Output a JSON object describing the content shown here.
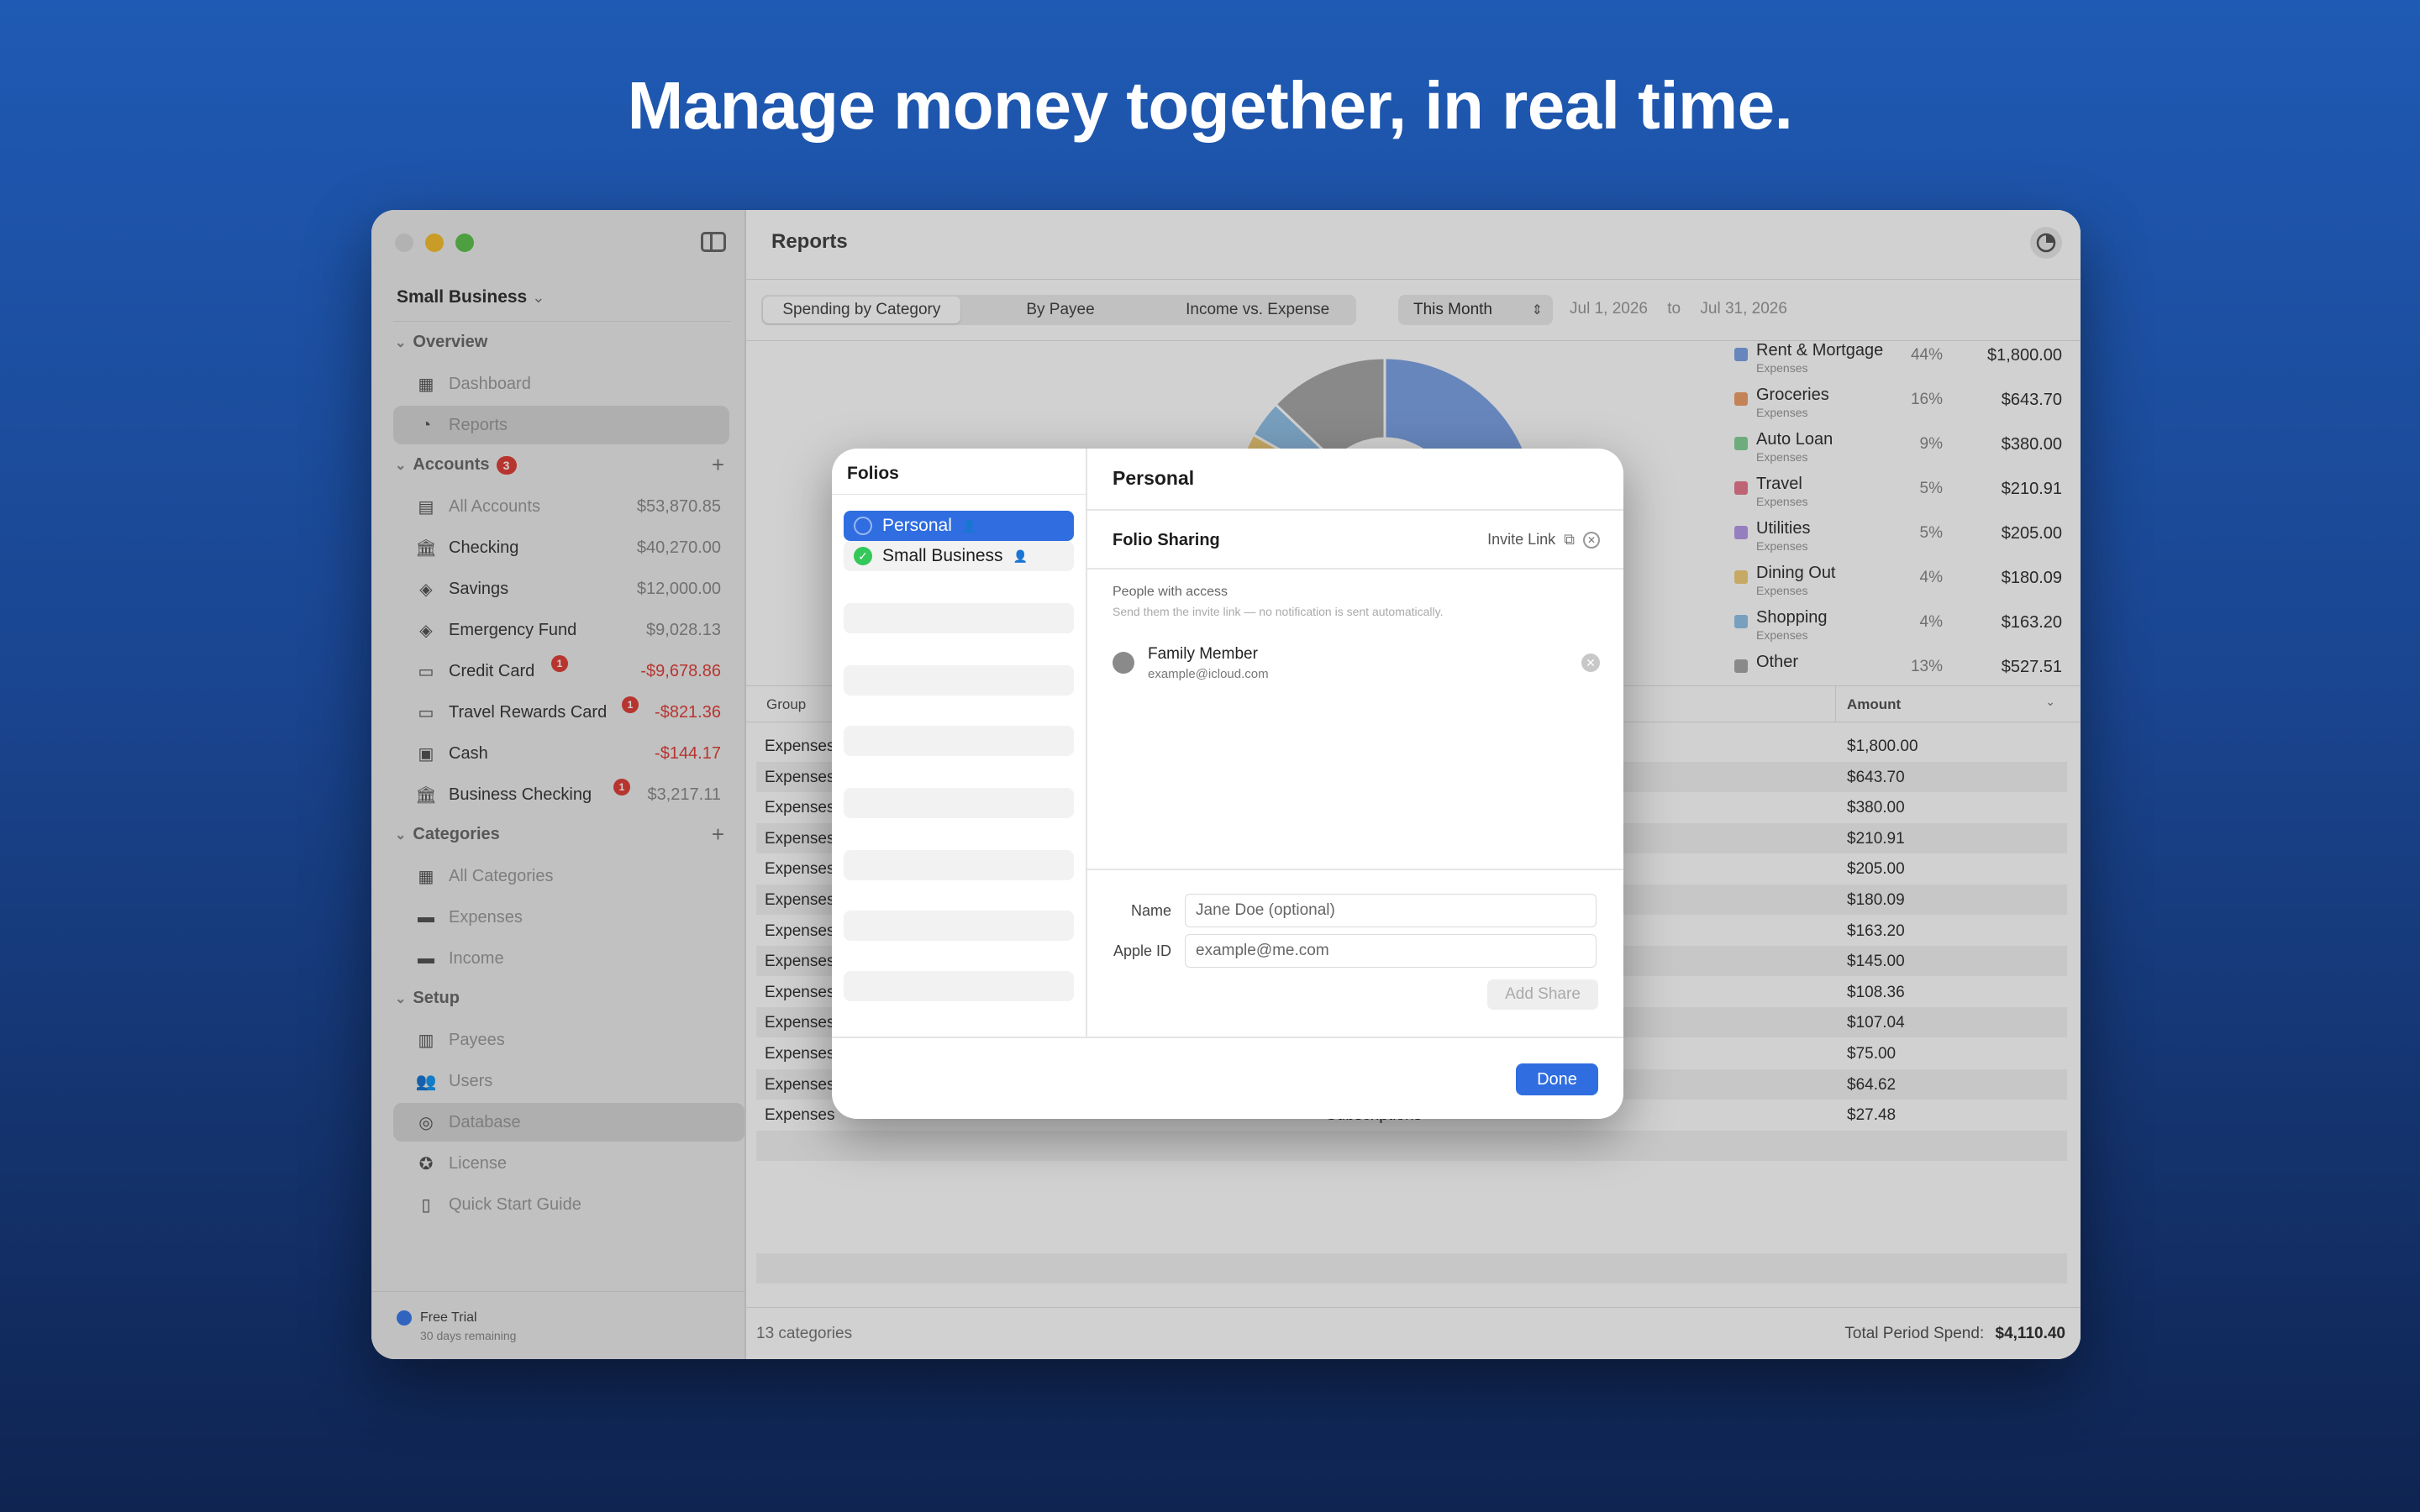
{
  "headline": "Manage money together, in real time.",
  "sidebar": {
    "folio": "Small Business",
    "sections": {
      "overview": "Overview",
      "accounts": "Accounts",
      "accounts_badge": "3",
      "categories": "Categories",
      "setup": "Setup"
    },
    "overview_items": [
      {
        "label": "Dashboard",
        "icon": "grid-icon"
      },
      {
        "label": "Reports",
        "icon": "pie-icon"
      }
    ],
    "accounts": [
      {
        "label": "All Accounts",
        "amount": "$53,870.85",
        "icon": "tray-icon"
      },
      {
        "label": "Checking",
        "amount": "$40,270.00",
        "icon": "bank-icon"
      },
      {
        "label": "Savings",
        "amount": "$12,000.00",
        "icon": "piggy-icon"
      },
      {
        "label": "Emergency Fund",
        "amount": "$9,028.13",
        "icon": "piggy-icon"
      },
      {
        "label": "Credit Card",
        "amount": "-$9,678.86",
        "icon": "card-icon",
        "badge": "1"
      },
      {
        "label": "Travel Rewards Card",
        "amount": "-$821.36",
        "icon": "card-icon",
        "badge": "1"
      },
      {
        "label": "Cash",
        "amount": "-$144.17",
        "icon": "cash-icon"
      },
      {
        "label": "Business Checking",
        "amount": "$3,217.11",
        "icon": "bank-icon",
        "badge": "1"
      }
    ],
    "categories": [
      {
        "label": "All Categories",
        "icon": "grid-icon"
      },
      {
        "label": "Expenses",
        "icon": "folder-icon"
      },
      {
        "label": "Income",
        "icon": "folder-icon"
      }
    ],
    "setup": [
      {
        "label": "Payees",
        "icon": "store-icon"
      },
      {
        "label": "Users",
        "icon": "users-icon"
      },
      {
        "label": "Database",
        "icon": "database-icon"
      },
      {
        "label": "License",
        "icon": "seal-icon"
      },
      {
        "label": "Quick Start Guide",
        "icon": "book-icon"
      }
    ],
    "trial": "Free Trial",
    "trial_sub": "30 days remaining"
  },
  "main": {
    "title": "Reports",
    "tabs": [
      "Spending by Category",
      "By Payee",
      "Income vs. Expense"
    ],
    "period": "This Month",
    "date_from": "Jul 1, 2026",
    "date_to_label": "to",
    "date_to": "Jul 31, 2026",
    "table_headers": {
      "group": "Group",
      "amount": "Amount"
    },
    "rows": [
      {
        "group": "Expenses",
        "category": "",
        "amount": "$1,800.00"
      },
      {
        "group": "Expenses",
        "category": "",
        "amount": "$643.70"
      },
      {
        "group": "Expenses",
        "category": "",
        "amount": "$380.00"
      },
      {
        "group": "Expenses",
        "category": "",
        "amount": "$210.91"
      },
      {
        "group": "Expenses",
        "category": "",
        "amount": "$205.00"
      },
      {
        "group": "Expenses",
        "category": "",
        "amount": "$180.09"
      },
      {
        "group": "Expenses",
        "category": "",
        "amount": "$163.20"
      },
      {
        "group": "Expenses",
        "category": "",
        "amount": "$145.00"
      },
      {
        "group": "Expenses",
        "category": "",
        "amount": "$108.36"
      },
      {
        "group": "Expenses",
        "category": "",
        "amount": "$107.04"
      },
      {
        "group": "Expenses",
        "category": "",
        "amount": "$75.00"
      },
      {
        "group": "Expenses",
        "category": "",
        "amount": "$64.62"
      },
      {
        "group": "Expenses",
        "category": "Subscriptions",
        "amount": "$27.48"
      }
    ],
    "footer_count": "13 categories",
    "footer_total_label": "Total Period Spend:",
    "footer_total": "$4,110.40"
  },
  "chart_data": {
    "type": "pie",
    "categories": [
      "Rent & Mortgage",
      "Groceries",
      "Auto Loan",
      "Travel",
      "Utilities",
      "Dining Out",
      "Shopping",
      "Other"
    ],
    "subtitles": [
      "Expenses",
      "Expenses",
      "Expenses",
      "Expenses",
      "Expenses",
      "Expenses",
      "Expenses",
      ""
    ],
    "percent_labels": [
      "44%",
      "16%",
      "9%",
      "5%",
      "5%",
      "4%",
      "4%",
      "13%"
    ],
    "values": [
      1800.0,
      643.7,
      380.0,
      210.91,
      205.0,
      180.09,
      163.2,
      527.51
    ],
    "value_labels": [
      "$1,800.00",
      "$643.70",
      "$380.00",
      "$210.91",
      "$205.00",
      "$180.09",
      "$163.20",
      "$527.51"
    ],
    "colors": [
      "#7ea4e6",
      "#f0a06a",
      "#87d29a",
      "#ea7a8e",
      "#b89be8",
      "#f2cf7a",
      "#93c2e8",
      "#a8a8a8"
    ],
    "legend": "right"
  },
  "modal": {
    "left_title": "Folios",
    "folios": [
      {
        "label": "Personal",
        "selected": true
      },
      {
        "label": "Small Business",
        "selected": false
      }
    ],
    "title": "Personal",
    "sharing_title": "Folio Sharing",
    "invite_link": "Invite Link",
    "people_title": "People with access",
    "people_sub": "Send them the invite link — no notification is sent automatically.",
    "member": {
      "name": "Family Member",
      "email": "example@icloud.com"
    },
    "name_label": "Name",
    "name_placeholder": "Jane Doe (optional)",
    "appleid_label": "Apple ID",
    "appleid_placeholder": "example@me.com",
    "add_share": "Add Share",
    "done": "Done"
  },
  "colors": {
    "accent": "#2f6de1",
    "negative": "#e0413a",
    "success": "#34c759"
  }
}
